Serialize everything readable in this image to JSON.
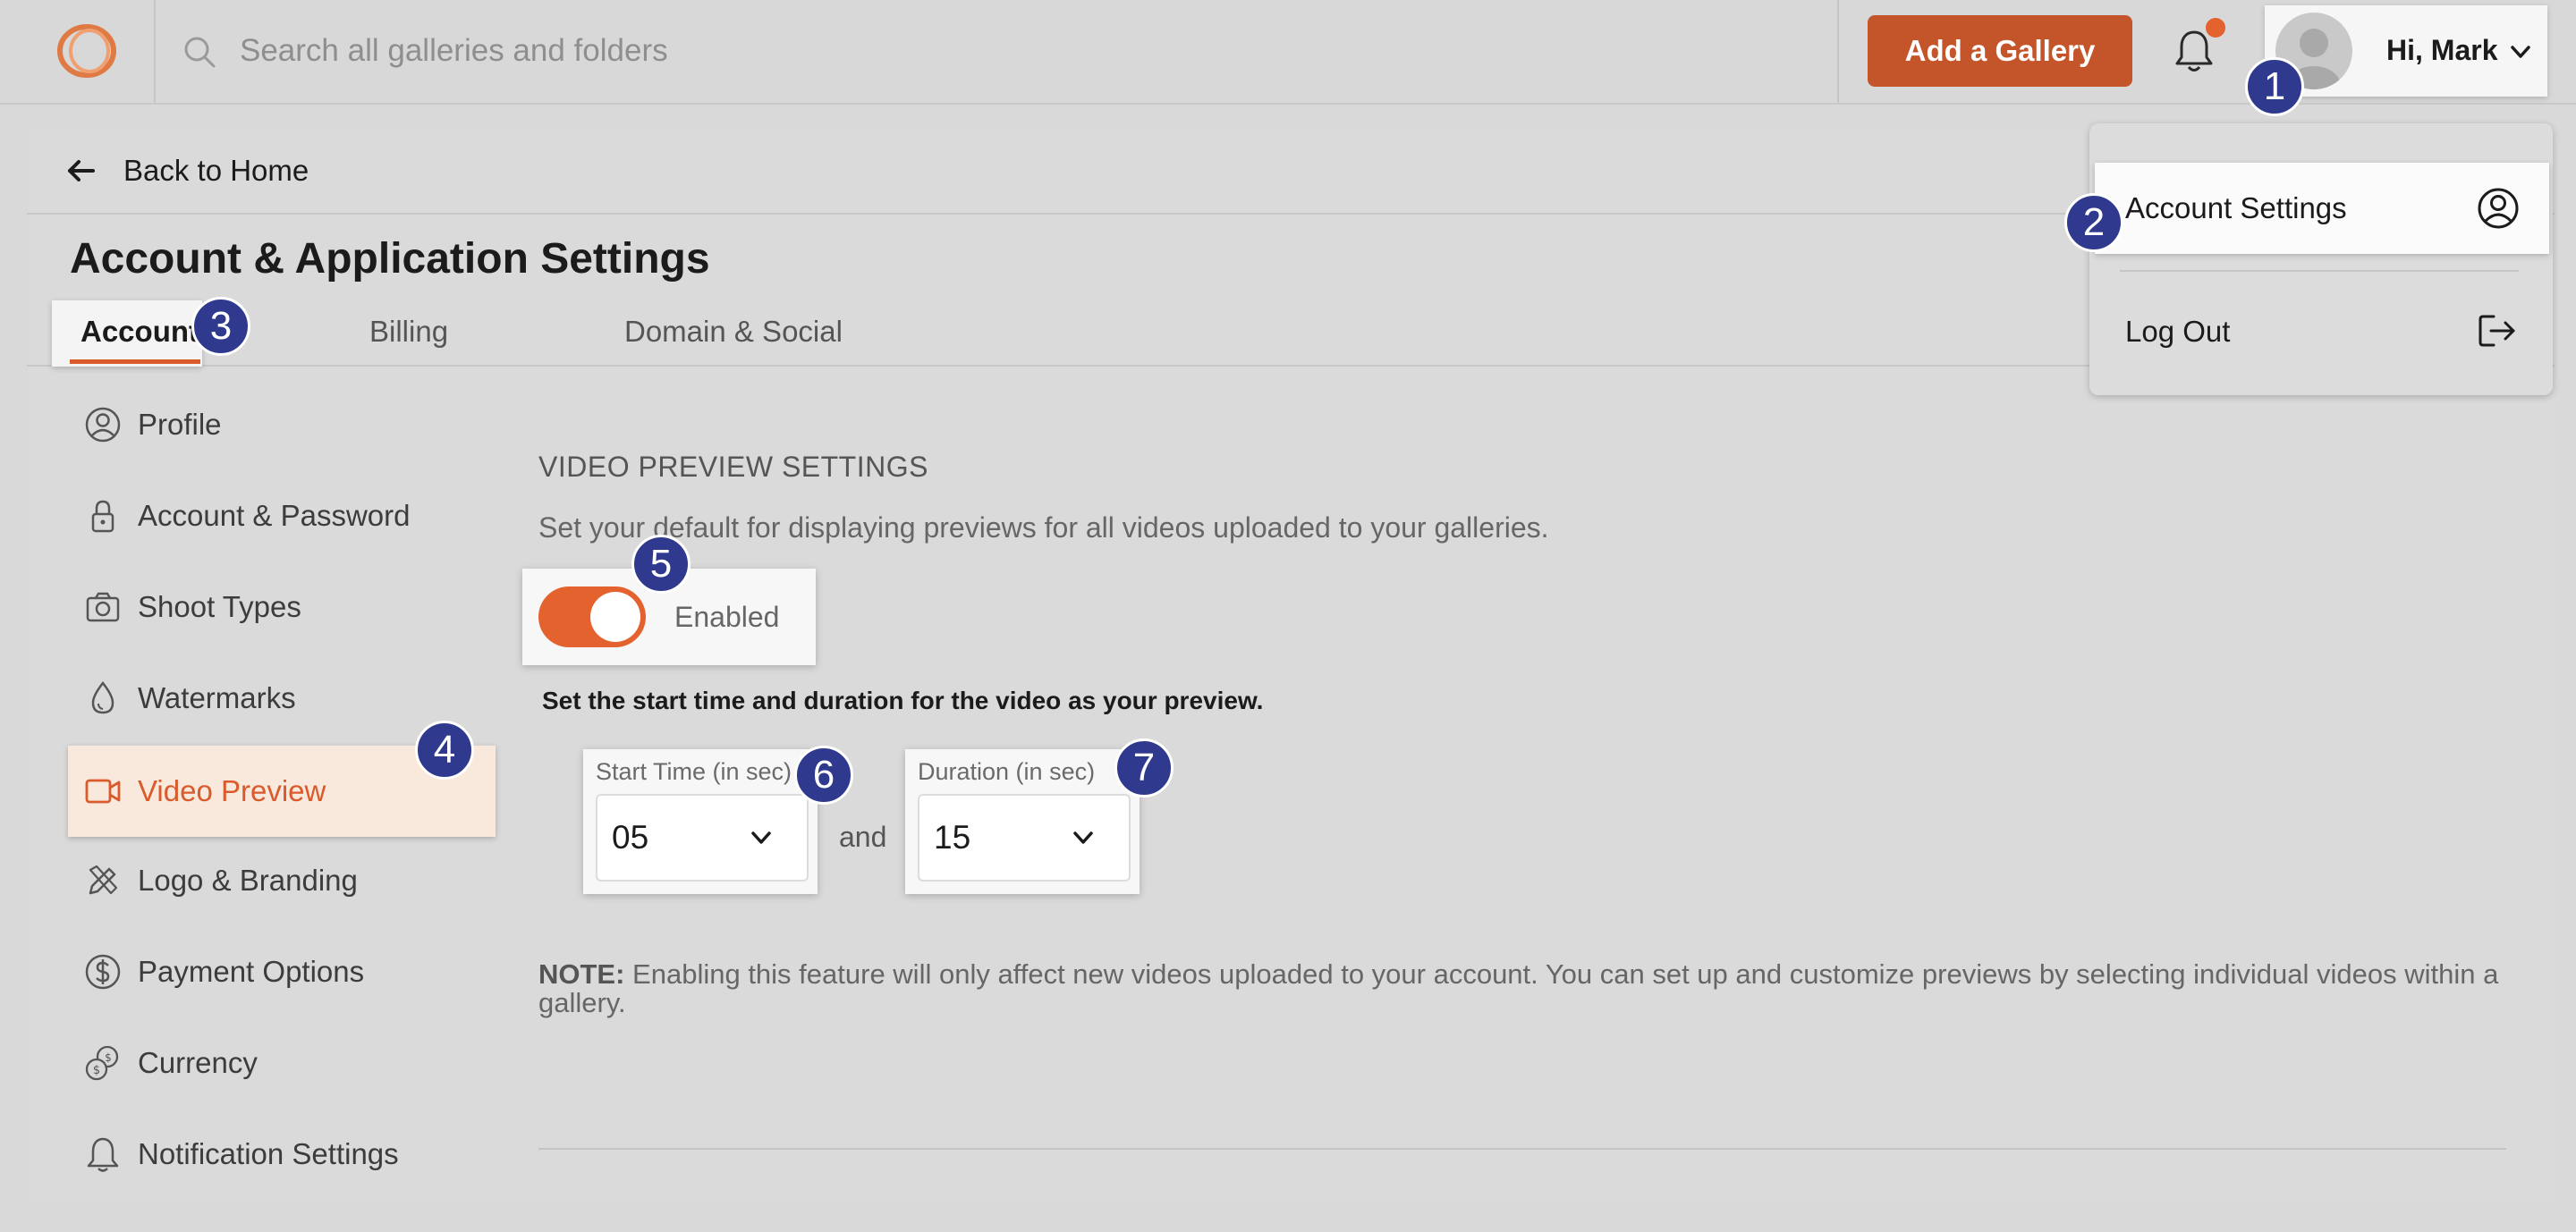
{
  "header": {
    "search_placeholder": "Search all galleries and folders",
    "add_gallery_label": "Add a Gallery",
    "greeting": "Hi, Mark",
    "accent_color": "#c4542a"
  },
  "back_link": "Back to Home",
  "page_title": "Account & Application Settings",
  "tabs": [
    {
      "label": "Account",
      "active": true
    },
    {
      "label": "Billing",
      "active": false
    },
    {
      "label": "Domain & Social",
      "active": false
    }
  ],
  "sidebar": {
    "items": [
      {
        "label": "Profile",
        "icon": "user-circle-icon"
      },
      {
        "label": "Account & Password",
        "icon": "lock-icon"
      },
      {
        "label": "Shoot Types",
        "icon": "camera-icon"
      },
      {
        "label": "Watermarks",
        "icon": "droplet-icon"
      },
      {
        "label": "Video Preview",
        "icon": "video-icon",
        "active": true
      },
      {
        "label": "Logo & Branding",
        "icon": "pencil-ruler-icon"
      },
      {
        "label": "Payment Options",
        "icon": "dollar-circle-icon"
      },
      {
        "label": "Currency",
        "icon": "coins-icon"
      },
      {
        "label": "Notification Settings",
        "icon": "bell-icon"
      }
    ]
  },
  "video_preview": {
    "section_title": "VIDEO PREVIEW SETTINGS",
    "description": "Set your default for displaying previews for all videos uploaded to your galleries.",
    "toggle_label": "Enabled",
    "toggle_on": true,
    "instruction": "Set the start time and duration for the video as your preview.",
    "start_time": {
      "label": "Start Time (in sec)",
      "value": "05"
    },
    "connector": "and",
    "duration": {
      "label": "Duration (in sec)",
      "value": "15"
    },
    "note_label": "NOTE:",
    "note_text": " Enabling this feature will only affect new videos uploaded to your account. You can set up and customize previews by selecting individual videos within a gallery."
  },
  "user_dropdown": {
    "items": [
      {
        "label": "Account Settings",
        "icon": "user-circle-icon"
      },
      {
        "label": "Log Out",
        "icon": "logout-icon"
      }
    ]
  },
  "markers": [
    "1",
    "2",
    "3",
    "4",
    "5",
    "6",
    "7"
  ]
}
